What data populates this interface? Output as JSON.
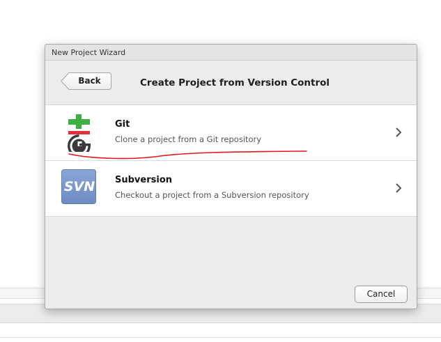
{
  "dialog": {
    "window_title": "New Project Wizard",
    "back_label": "Back",
    "heading": "Create Project from Version Control",
    "cancel_label": "Cancel"
  },
  "options": [
    {
      "title": "Git",
      "description": "Clone a project from a Git repository",
      "icon": "git-icon"
    },
    {
      "title": "Subversion",
      "description": "Checkout a project from a Subversion repository",
      "icon": "svn-icon",
      "icon_text": "SVN"
    }
  ],
  "colors": {
    "git_green": "#3cb043",
    "git_red": "#e0303a",
    "git_dark": "#3a3a3a",
    "svn_blue": "#7e9bd0",
    "annotation_red": "#e8161c"
  }
}
